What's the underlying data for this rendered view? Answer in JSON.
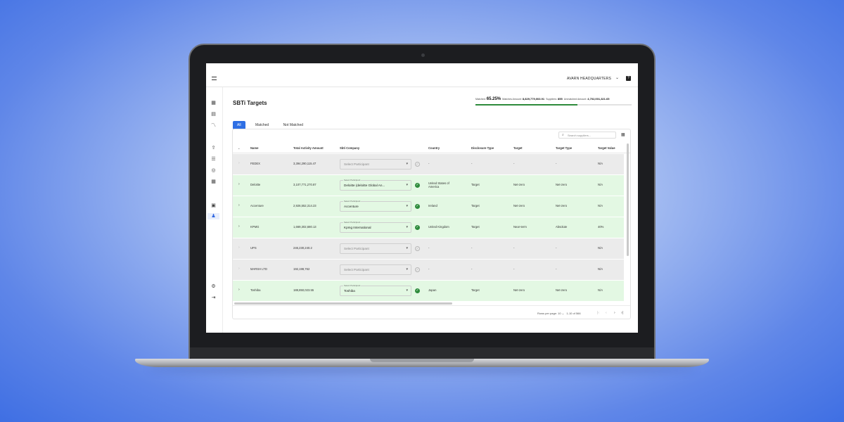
{
  "header": {
    "org_name": "AVARN HEADQUARTERS",
    "org_chevron": "⌄",
    "help_icon": "?"
  },
  "page": {
    "title": "SBTi Targets"
  },
  "stats": {
    "matched_label": "Matched:",
    "matched_pct": "65.25%",
    "matched_amount_label": "Matches Amount:",
    "matched_amount": "8,829,779,003.91",
    "suppliers_label": "Suppliers:",
    "suppliers": "855",
    "unmatched_amount_label": "Unmatched Amount:",
    "unmatched_amount": "4,702,001,321.65",
    "progress_fraction": 0.6525
  },
  "tabs": [
    {
      "label": "All"
    },
    {
      "label": "Matched"
    },
    {
      "label": "Not Matched"
    }
  ],
  "search": {
    "placeholder": "Search suppliers..."
  },
  "columns": {
    "name": "Name",
    "amount": "Total Activity Amount",
    "company": "Sbti Company",
    "country": "Country",
    "disclosure": "Disclosure Type",
    "target": "Target",
    "target_type": "Target Type",
    "target_value": "Target Value"
  },
  "select_label": "Select Participant",
  "select_placeholder": "Select Participant",
  "rows": [
    {
      "name": "FEDEX",
      "amount": "3,394,290,115.47",
      "company": "",
      "country": "-",
      "disclosure": "-",
      "target": "-",
      "target_type": "-",
      "target_value": "N/A",
      "matched": false
    },
    {
      "name": "Deloitte",
      "amount": "3,107,771,270.87",
      "company": "Deloitte (deloitte Global An...",
      "country": "United States of America",
      "disclosure": "Target",
      "target": "Net-zero",
      "target_type": "Net-zero",
      "target_value": "N/A",
      "matched": true
    },
    {
      "name": "Accenture",
      "amount": "2,926,552,314.23",
      "company": "Accenture",
      "country": "Ireland",
      "disclosure": "Target",
      "target": "Net-zero",
      "target_type": "Net-zero",
      "target_value": "N/A",
      "matched": true
    },
    {
      "name": "KPMG",
      "amount": "1,669,302,680.13",
      "company": "Kpmg International",
      "country": "United Kingdom",
      "disclosure": "Target",
      "target": "Near-term",
      "target_type": "Absolute",
      "target_value": "40%",
      "matched": true
    },
    {
      "name": "UPS",
      "amount": "246,230,240.2",
      "company": "",
      "country": "-",
      "disclosure": "-",
      "target": "-",
      "target_type": "-",
      "target_value": "N/A",
      "matched": false
    },
    {
      "name": "MARSH LTD",
      "amount": "192,198,762",
      "company": "",
      "country": "-",
      "disclosure": "-",
      "target": "-",
      "target_type": "-",
      "target_value": "N/A",
      "matched": false
    },
    {
      "name": "Toshiba",
      "amount": "188,850,023.55",
      "company": "Toshiba",
      "country": "Japan",
      "disclosure": "Target",
      "target": "Net-zero",
      "target_type": "Net-zero",
      "target_value": "N/A",
      "matched": true
    }
  ],
  "pagination": {
    "rows_per_page_label": "Rows per page:",
    "rows_per_page": "10",
    "range": "1-10 of 566"
  },
  "icons": {
    "menu": "menu-icon",
    "dashboard": "dashboard-icon",
    "ledger": "ledger-icon",
    "trend": "trend-icon",
    "upload": "upload-icon",
    "list": "list-icon",
    "target": "target-icon",
    "grid": "grid-icon",
    "report": "report-icon",
    "person": "person-icon",
    "settings": "settings-icon",
    "logout": "logout-icon"
  },
  "colors": {
    "accent": "#2f6fe4",
    "matched_row": "#e3f8e3",
    "unmatched_row": "#ebebeb",
    "success": "#2e8b3c"
  }
}
